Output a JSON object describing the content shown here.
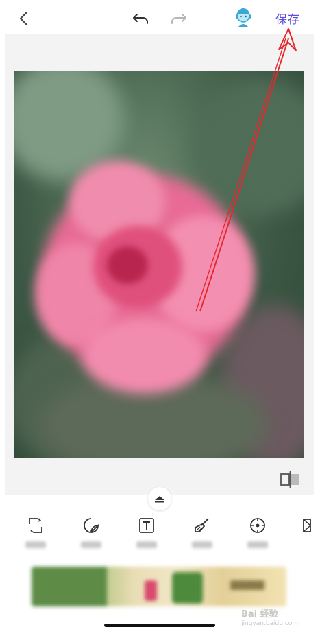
{
  "toolbar": {
    "save_label": "保存"
  },
  "watermark": {
    "brand": "Bai 经验",
    "domain": "jingyan.baidu.com"
  },
  "colors": {
    "accent": "#5a4fd8",
    "arrow": "#e8262d"
  },
  "icons": [
    "back-icon",
    "undo-icon",
    "redo-icon",
    "avatar-icon",
    "compare-icon",
    "expand-up-icon",
    "crop-rotate-icon",
    "sticker-icon",
    "text-icon",
    "brush-icon",
    "focus-icon",
    "frame-icon"
  ]
}
